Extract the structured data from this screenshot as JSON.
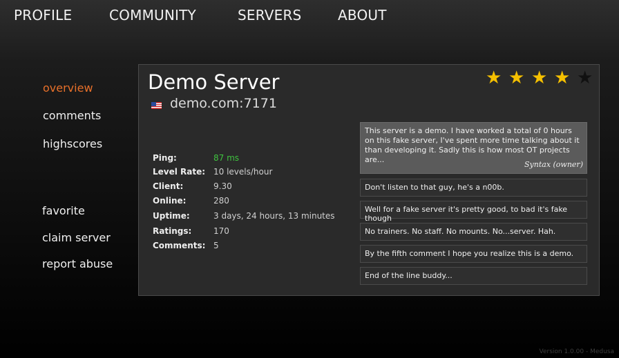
{
  "topnav": [
    "PROFILE",
    "COMMUNITY",
    "SERVERS",
    "ABOUT"
  ],
  "sidenav": {
    "primary": [
      "overview",
      "comments",
      "highscores"
    ],
    "secondary": [
      "favorite",
      "claim server",
      "report abuse"
    ],
    "active": "overview"
  },
  "server": {
    "name": "Demo Server",
    "host": "demo.com:7171",
    "flag_icon": "us-flag-icon",
    "rating_stars": 4,
    "rating_max": 5
  },
  "stats": [
    {
      "label": "Ping:",
      "value": "87 ms",
      "color": "#3fc33f"
    },
    {
      "label": "Level Rate:",
      "value": "10 levels/hour"
    },
    {
      "label": "Client:",
      "value": "9.30"
    },
    {
      "label": "Online:",
      "value": "280"
    },
    {
      "label": "Uptime:",
      "value": "3 days, 24 hours, 13 minutes"
    },
    {
      "label": "Ratings:",
      "value": "170"
    },
    {
      "label": "Comments:",
      "value": "5"
    }
  ],
  "owner_comment": {
    "text": "This server is a demo. I have worked a total of 0 hours on this fake server, I've spent more time talking about it than developing it. Sadly this is how most OT projects are...",
    "signature": "Syntax (owner)"
  },
  "comments": [
    "Don't listen to that guy, he's a n00b.",
    "Well for a fake server it's pretty good, to bad it's fake though",
    "No trainers. No staff. No mounts. No...server. Hah.",
    "By the fifth comment I hope you realize this is a demo.",
    "End of the line buddy..."
  ],
  "footer": "Version 1.0.00 - Medusa",
  "colors": {
    "accent": "#e8702a",
    "star_on": "#f5c000",
    "star_off": "#111111"
  }
}
